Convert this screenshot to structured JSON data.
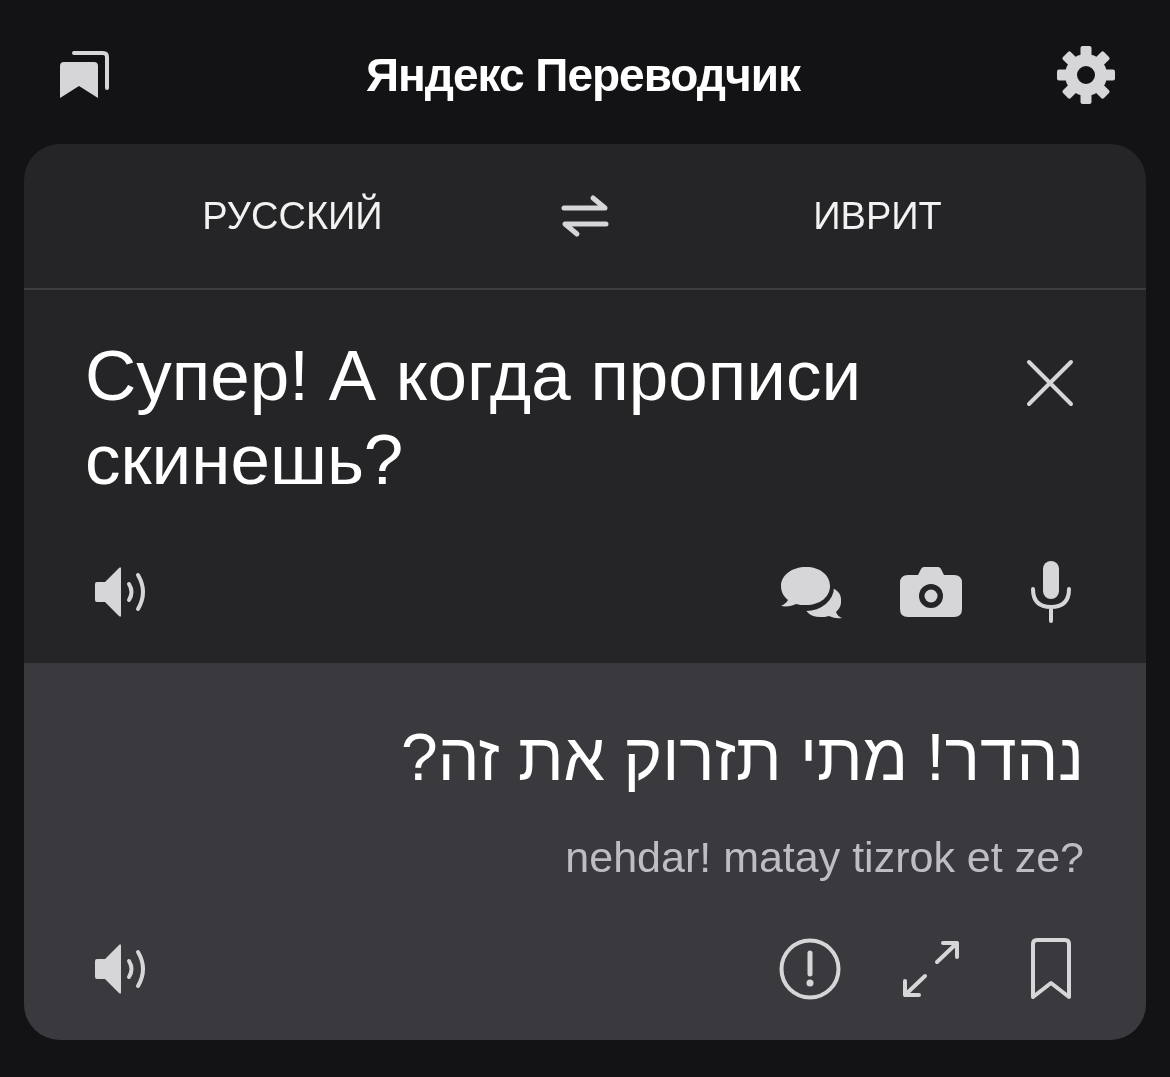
{
  "header": {
    "title": "Яндекс Переводчик"
  },
  "languages": {
    "source": "РУССКИЙ",
    "target": "ИВРИТ"
  },
  "input": {
    "text": "Супер! А когда прописи скинешь?"
  },
  "output": {
    "text": "נהדר! מתי תזרוק את זה?",
    "transliteration": "nehdar! matay tizrok et ze?"
  }
}
